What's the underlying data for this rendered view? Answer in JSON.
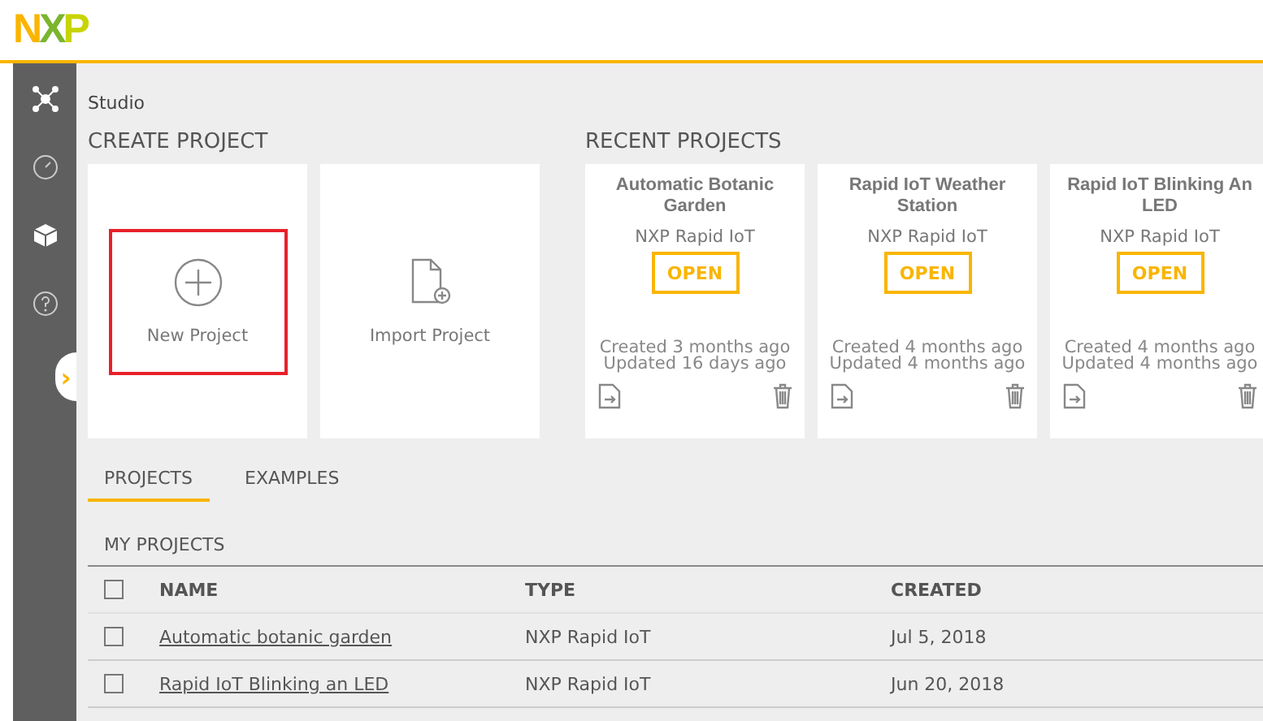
{
  "logo": "NXP",
  "sidebar": {
    "items": [
      {
        "kind": "hub",
        "selected": false
      },
      {
        "kind": "gauge",
        "selected": false
      },
      {
        "kind": "cube",
        "selected": false
      },
      {
        "kind": "help",
        "selected": false
      }
    ],
    "toggle": "›"
  },
  "breadcrumb": "Studio",
  "create": {
    "title": "CREATE PROJECT",
    "cards": [
      {
        "kind": "new",
        "label": "New Project",
        "highlighted": true
      },
      {
        "kind": "import",
        "label": "Import Project",
        "highlighted": false
      }
    ]
  },
  "recent": {
    "title": "RECENT PROJECTS",
    "cards": [
      {
        "title": "Automatic Botanic Garden",
        "type": "NXP Rapid IoT",
        "button": "OPEN",
        "created": "Created 3 months ago",
        "updated": "Updated 16 days ago"
      },
      {
        "title": "Rapid IoT Weather Station",
        "type": "NXP Rapid IoT",
        "button": "OPEN",
        "created": "Created 4 months ago",
        "updated": "Updated 4 months ago"
      },
      {
        "title": "Rapid IoT Blinking An LED",
        "type": "NXP Rapid IoT",
        "button": "OPEN",
        "created": "Created 4 months ago",
        "updated": "Updated 4 months ago"
      }
    ]
  },
  "tabs": [
    {
      "label": "PROJECTS",
      "selected": true
    },
    {
      "label": "EXAMPLES",
      "selected": false
    }
  ],
  "section": "MY PROJECTS",
  "table": {
    "select_all_checked": false,
    "columns": [
      "NAME",
      "TYPE",
      "CREATED"
    ],
    "rows": [
      {
        "checked": false,
        "name": "Automatic botanic garden",
        "type": "NXP Rapid IoT",
        "created": "Jul 5, 2018"
      },
      {
        "checked": false,
        "name": "Rapid IoT Blinking an LED",
        "type": "NXP Rapid IoT",
        "created": "Jun 20, 2018"
      }
    ]
  }
}
